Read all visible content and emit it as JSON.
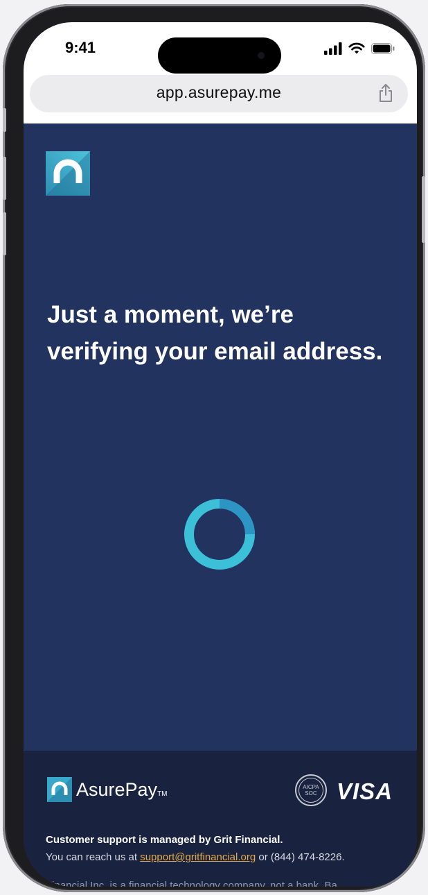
{
  "status_bar": {
    "time": "9:41",
    "icons": [
      "signal-icon",
      "wifi-icon",
      "battery-icon"
    ]
  },
  "browser": {
    "url": "app.asurepay.me",
    "share_icon": "share-icon"
  },
  "page": {
    "logo_icon": "asurepay-logo-icon",
    "heading_line1": "Just a moment, we’re",
    "heading_line2": "verifying your email address.",
    "spinner_icon": "loading-spinner-icon"
  },
  "footer": {
    "brand_name": "AsurePay",
    "brand_tm": "TM",
    "aicpa_line1": "AICPA",
    "aicpa_line2": "SOC",
    "visa_label": "VISA",
    "support_title": "Customer support is managed by Grit Financial.",
    "support_prefix": "You can reach us at ",
    "support_email": "support@gritfinancial.org",
    "support_suffix": " or (844) 474-8226.",
    "disclaimer": "Financial Inc. is a financial technology company, not a bank. Ba"
  },
  "colors": {
    "page_background": "#22335f",
    "footer_background": "#192340",
    "accent_teal": "#36b3cf",
    "link": "#e3a94a"
  }
}
